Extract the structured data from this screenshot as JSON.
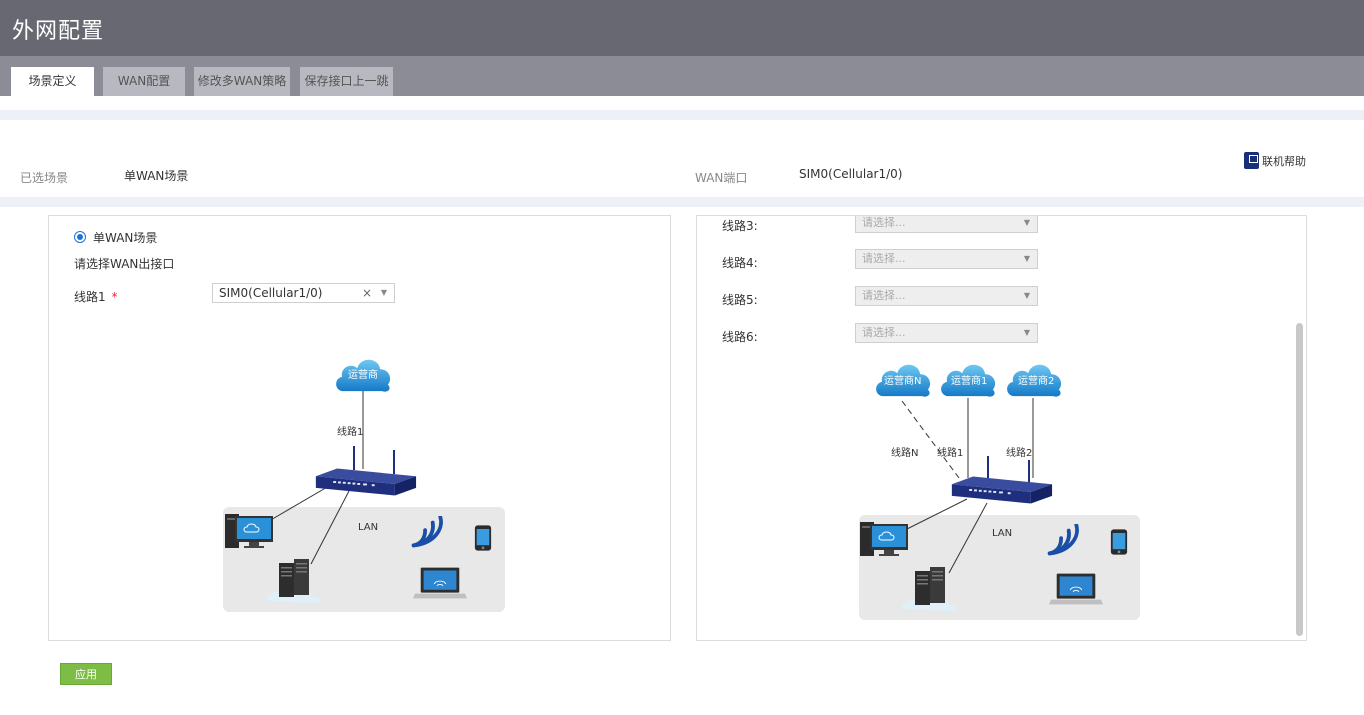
{
  "header": {
    "title": "外网配置"
  },
  "tabs": [
    {
      "label": "场景定义"
    },
    {
      "label": "WAN配置"
    },
    {
      "label": "修改多WAN策略"
    },
    {
      "label": "保存接口上一跳"
    }
  ],
  "info": {
    "scene_label": "已选场景",
    "scene_value": "单WAN场景",
    "wan_label": "WAN端口",
    "wan_value": "SIM0(Cellular1/0)",
    "help_label": "联机帮助"
  },
  "left_panel": {
    "radio_label": "单WAN场景",
    "prompt": "请选择WAN出接口",
    "line1_label": "线路1",
    "required_mark": "*",
    "line1_value": "SIM0(Cellular1/0)",
    "diagram": {
      "cloud": "运营商",
      "line": "线路1",
      "lan": "LAN"
    }
  },
  "right_panel": {
    "lines": [
      {
        "label": "线路3:",
        "placeholder": "请选择..."
      },
      {
        "label": "线路4:",
        "placeholder": "请选择..."
      },
      {
        "label": "线路5:",
        "placeholder": "请选择..."
      },
      {
        "label": "线路6:",
        "placeholder": "请选择..."
      }
    ],
    "diagram": {
      "cloud_n": "运营商N",
      "cloud_1": "运营商1",
      "cloud_2": "运营商2",
      "line_n": "线路N",
      "line_1": "线路1",
      "line_2": "线路2",
      "lan": "LAN"
    }
  },
  "apply_label": "应用",
  "colors": {
    "header": "#686873",
    "tabbar": "#8c8c96",
    "apply": "#7dbd45",
    "radio": "#1e73d6",
    "device": "#1f2f7e"
  }
}
